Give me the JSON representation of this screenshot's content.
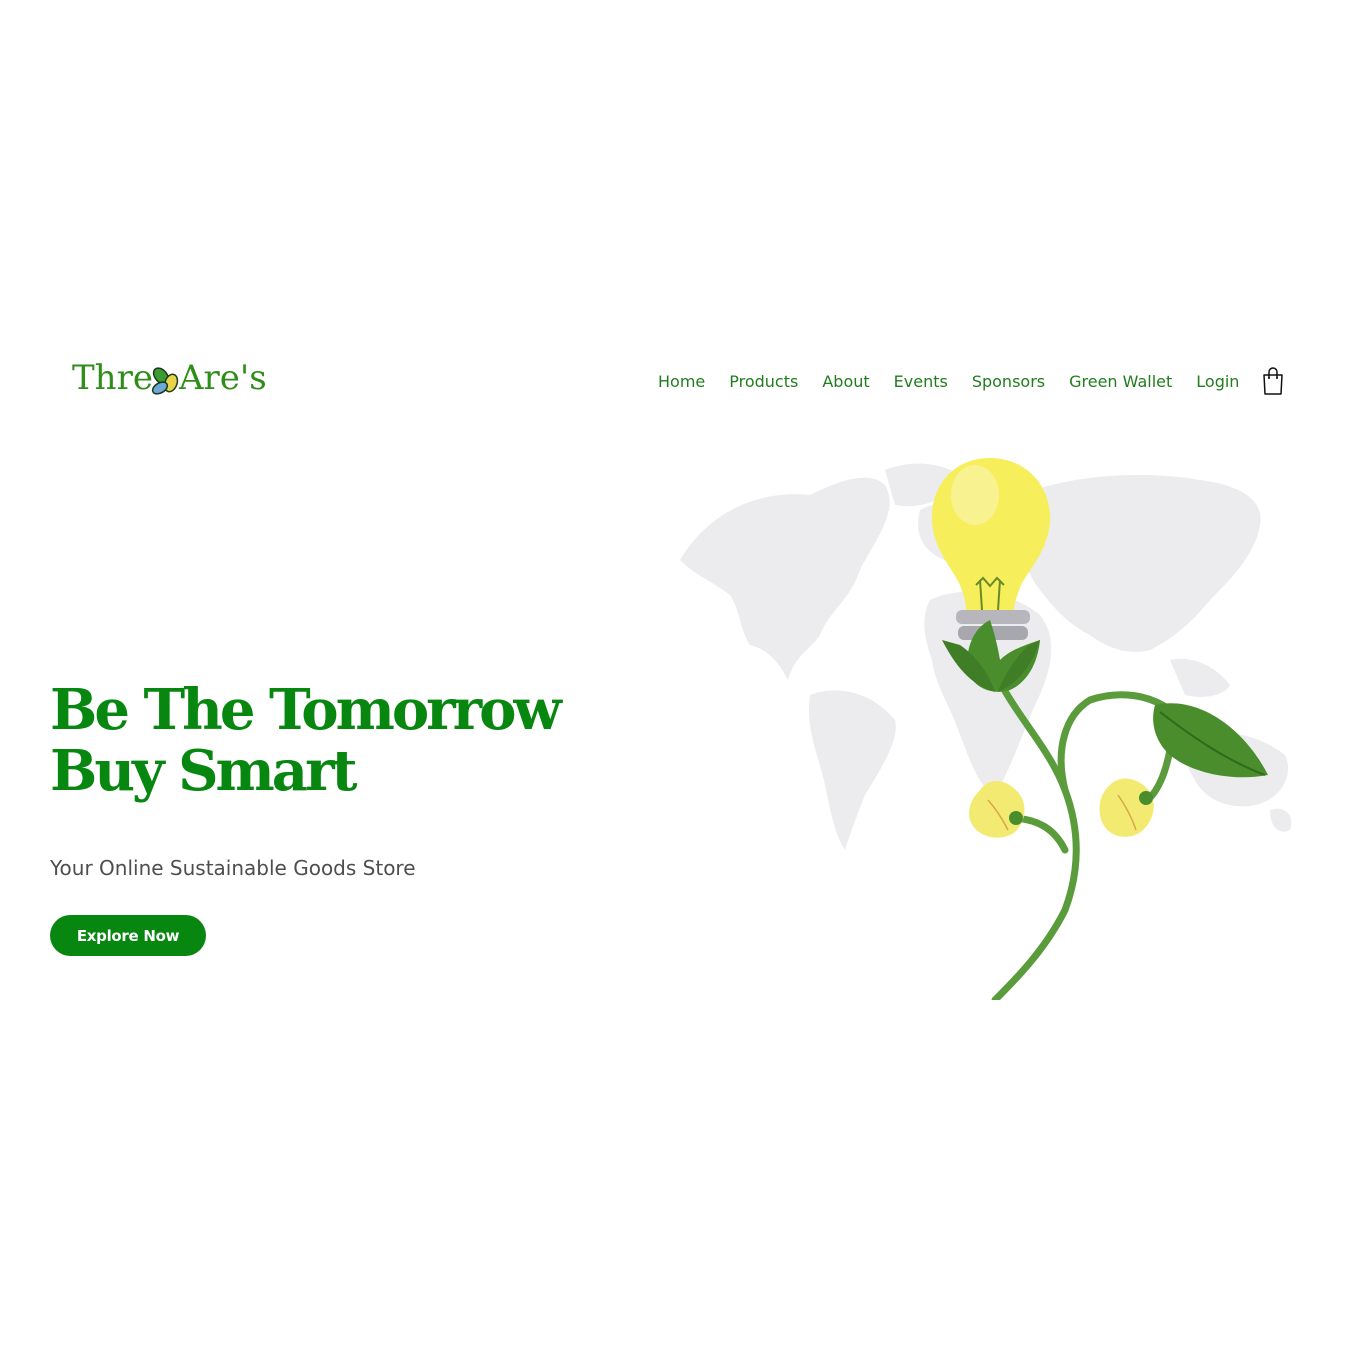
{
  "brand": {
    "logo_left": "Thre",
    "logo_right": "Are's",
    "color": "#2f8d1a"
  },
  "nav": {
    "items": [
      {
        "label": "Home"
      },
      {
        "label": "Products"
      },
      {
        "label": "About"
      },
      {
        "label": "Events"
      },
      {
        "label": "Sponsors"
      },
      {
        "label": "Green Wallet"
      },
      {
        "label": "Login"
      }
    ],
    "cart_icon": "shopping-bag-icon",
    "color": "#217d1e"
  },
  "hero": {
    "title_line1": "Be The Tomorrow",
    "title_line2": "Buy Smart",
    "subtitle": "Your Online Sustainable Goods Store",
    "cta_label": "Explore Now",
    "accent": "#078710",
    "illustration_icon": "lightbulb-plant-world-map-icon"
  }
}
